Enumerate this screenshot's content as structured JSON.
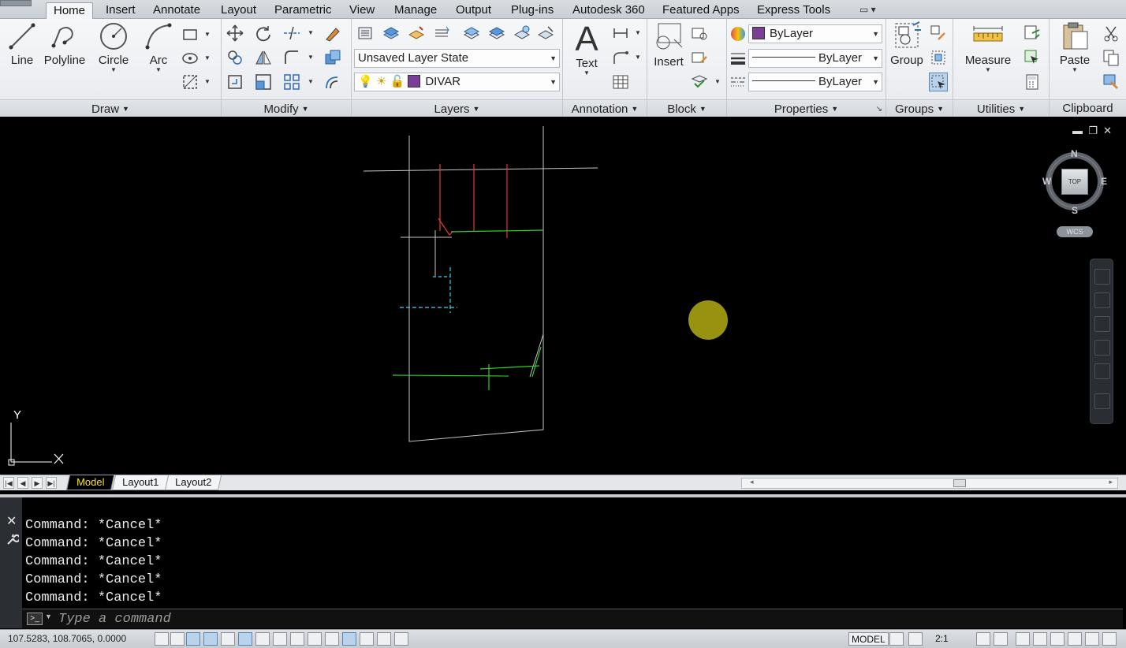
{
  "ribbon": {
    "tabs": [
      "Home",
      "Insert",
      "Annotate",
      "Layout",
      "Parametric",
      "View",
      "Manage",
      "Output",
      "Plug-ins",
      "Autodesk 360",
      "Featured Apps",
      "Express Tools"
    ],
    "active_tab": "Home",
    "panels": {
      "draw": {
        "title": "Draw",
        "line": "Line",
        "polyline": "Polyline",
        "circle": "Circle",
        "arc": "Arc"
      },
      "modify": {
        "title": "Modify"
      },
      "layers": {
        "title": "Layers",
        "layer_state": "Unsaved Layer State",
        "current_layer": "DIVAR",
        "layer_color": "#7b3f98"
      },
      "annotation": {
        "title": "Annotation",
        "text": "Text"
      },
      "block": {
        "title": "Block",
        "insert": "Insert"
      },
      "properties": {
        "title": "Properties",
        "color": "ByLayer",
        "lineweight": "ByLayer",
        "linetype": "ByLayer",
        "color_swatch": "#7b3f98"
      },
      "groups": {
        "title": "Groups",
        "group": "Group"
      },
      "utilities": {
        "title": "Utilities",
        "measure": "Measure"
      },
      "clipboard": {
        "title": "Clipboard",
        "paste": "Paste"
      }
    }
  },
  "viewport": {
    "viewcube": {
      "north": "N",
      "south": "S",
      "east": "E",
      "west": "W",
      "face": "TOP"
    },
    "wcs": "WCS",
    "ucs": {
      "y": "Y"
    }
  },
  "layout_tabs": [
    "Model",
    "Layout1",
    "Layout2"
  ],
  "active_layout": "Model",
  "command": {
    "history": [
      "Command: *Cancel*",
      "Command: *Cancel*",
      "Command: *Cancel*",
      "Command: *Cancel*",
      "Command: *Cancel*"
    ],
    "placeholder": "Type a command"
  },
  "status": {
    "coordinates": "107.5283, 108.7065, 0.0000",
    "model": "MODEL",
    "annotation_scale": "2:1"
  }
}
